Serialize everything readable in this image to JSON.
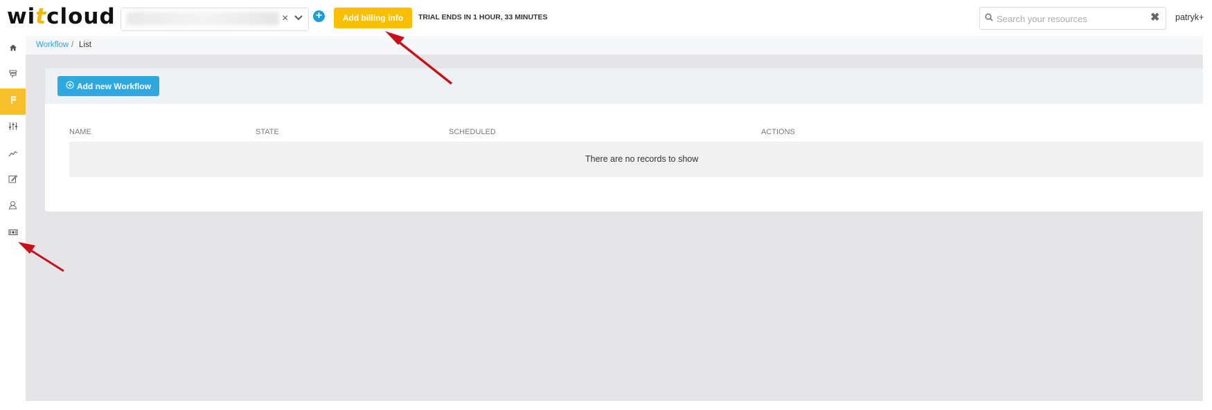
{
  "header": {
    "logo_prefix": "wi",
    "logo_accent": "t",
    "logo_suffix": "cloud",
    "tenant_clear": "×",
    "add_billing_label": "Add billing info",
    "trial_text": "TRIAL ENDS IN 1 HOUR, 33 MINUTES",
    "search_placeholder": "Search your resources",
    "search_clear": "✖",
    "user_name": "patryk+"
  },
  "sidebar": {
    "items": [
      {
        "icon": "home-icon"
      },
      {
        "icon": "signpost-icon"
      },
      {
        "icon": "workflow-icon",
        "active": true
      },
      {
        "icon": "sliders-icon"
      },
      {
        "icon": "line-chart-icon"
      },
      {
        "icon": "edit-icon"
      },
      {
        "icon": "user-icon"
      },
      {
        "icon": "billing-icon"
      }
    ]
  },
  "breadcrumb": {
    "link": "Workflow",
    "separator": "/",
    "current": "List"
  },
  "workflow": {
    "add_button_label": "Add new Workflow",
    "columns": [
      "NAME",
      "STATE",
      "SCHEDULED",
      "ACTIONS"
    ],
    "empty_message": "There are no records to show"
  },
  "colors": {
    "brand_accent": "#f5b800",
    "billing_button": "#f9c000",
    "primary_blue": "#2ea8df",
    "sidebar_active": "#f7bf2b",
    "annotation_arrow": "#c8101b"
  }
}
